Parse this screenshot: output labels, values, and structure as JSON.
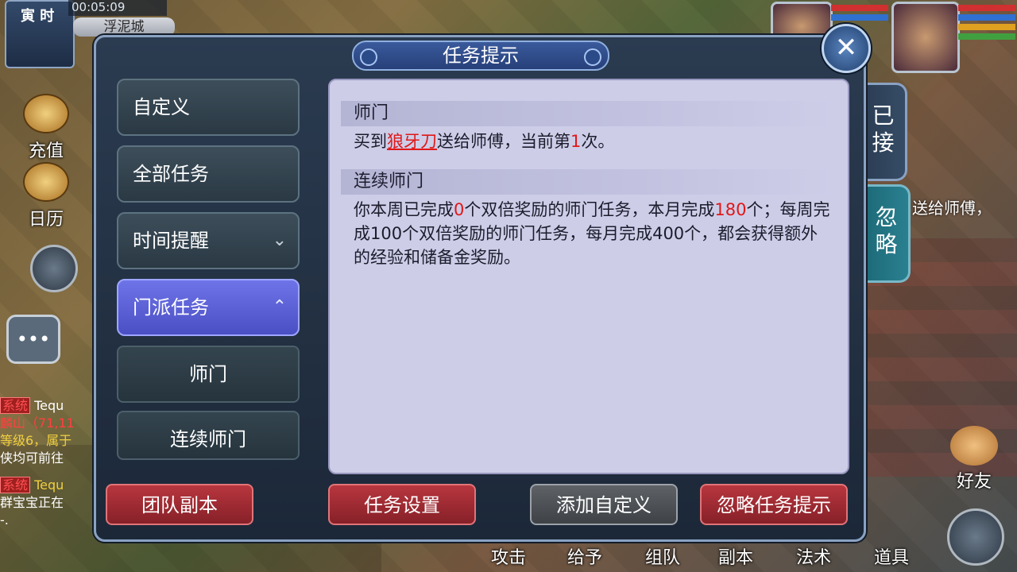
{
  "hud": {
    "shichen": "寅 时",
    "clock": "00:05:09",
    "city": "浮泥城",
    "recharge_label": "充值",
    "calendar_label": "日历",
    "friends_label": "好友",
    "bottom": [
      "攻击",
      "给予",
      "组队",
      "副本",
      "法术",
      "道具"
    ]
  },
  "chat": {
    "line1": {
      "tag": "系统",
      "name": "Tequ"
    },
    "line2": "麟山（71,11",
    "line3": "等级6，属于",
    "line4": "侠均可前往",
    "line5": {
      "tag": "系统",
      "name": "Tequ"
    },
    "line6": "群宝宝正在",
    "line7": "-."
  },
  "dialog": {
    "title": "任务提示",
    "close": "✕",
    "menu": [
      {
        "label": "自定义"
      },
      {
        "label": "全部任务"
      },
      {
        "label": "时间提醒",
        "chevron": "⌄"
      },
      {
        "label": "门派任务",
        "chevron": "⌃"
      }
    ],
    "submenu": [
      {
        "label": "师门"
      },
      {
        "label": "连续师门"
      }
    ],
    "tabs": {
      "accepted": "已接",
      "ignored": "忽略"
    },
    "ignored_peek": "送给师傅，",
    "sections": [
      {
        "title": "师门",
        "text_parts": [
          "买到",
          "狼牙刀",
          "送给师傅，当前第",
          "1",
          "次。"
        ]
      },
      {
        "title": "连续师门",
        "text_parts": [
          "你本周已完成",
          "0",
          "个双倍奖励的师门任务，本月完成",
          "180",
          "个；每周完成100个双倍奖励的师门任务，每月完成400个，都会获得额外的经验和储备金奖励。"
        ]
      }
    ],
    "buttons": {
      "team_dungeon": "团队副本",
      "task_settings": "任务设置",
      "add_custom": "添加自定义",
      "ignore_hint": "忽略任务提示"
    }
  },
  "colors": {
    "highlight_red": "#e01818",
    "panel_bg": "#cdcde8",
    "active_menu": "#5a60d8"
  }
}
